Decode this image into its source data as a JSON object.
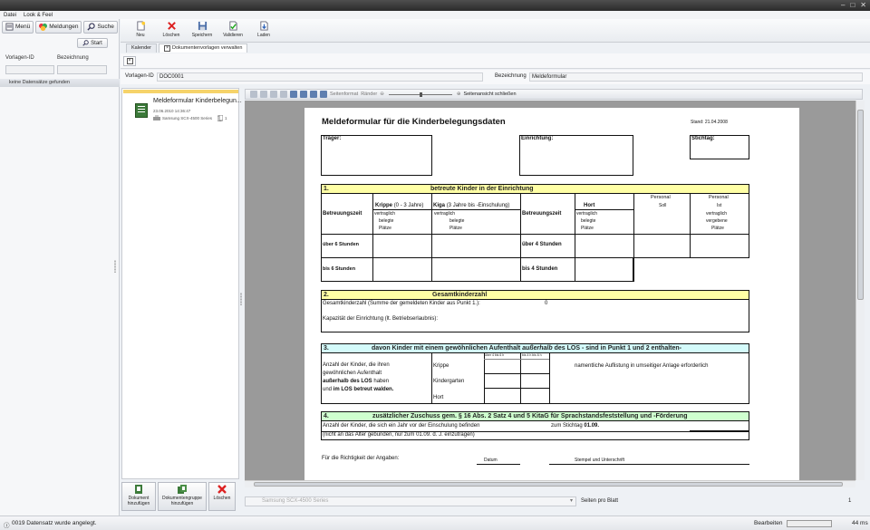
{
  "menu": [
    "Datei",
    "Look & Feel"
  ],
  "left_toolbar": {
    "menu_label": "Menü",
    "messages_label": "Meldungen",
    "search_label": "Suche",
    "start_label": "Start"
  },
  "search_form": {
    "template_id_label": "Vorlagen-ID",
    "name_label": "Bezeichnung",
    "no_records": "keine Datensätze gefunden"
  },
  "ribbon": [
    {
      "label": "Neu",
      "icon": "new-document-icon"
    },
    {
      "label": "Löschen",
      "icon": "delete-icon"
    },
    {
      "label": "Speichern",
      "icon": "save-icon"
    },
    {
      "label": "Validieren",
      "icon": "validate-icon"
    },
    {
      "label": "Laden",
      "icon": "load-icon"
    }
  ],
  "tabs": [
    {
      "label": "Kalender"
    },
    {
      "label": "Dokumentenvorlagen verwalten"
    }
  ],
  "record": {
    "template_id_label": "Vorlagen-ID",
    "template_id_value": "DOC0001",
    "name_label": "Bezeichnung",
    "name_value": "Meldeformular"
  },
  "document": {
    "title": "Meldeformular Kinderbelegun...",
    "date": "23.06.2010 14:36:47",
    "printer": "Samsung SCX-4500 Series",
    "copies": "1"
  },
  "doc_buttons": [
    {
      "line1": "Dokument",
      "line2": "hinzufügen",
      "icon": "add-document-icon"
    },
    {
      "line1": "Dokumentengruppe",
      "line2": "hinzufügen",
      "icon": "add-document-group-icon"
    },
    {
      "line1": "Löschen",
      "line2": "",
      "icon": "delete-icon"
    }
  ],
  "preview_toolbar": {
    "page_format": "Seitenformat",
    "margins": "Ränder",
    "close_view": "Seitenansicht schließen"
  },
  "form": {
    "title": "Meldeformular für die Kinderbelegungsdaten",
    "stand": "Stand: 21.04.2008",
    "traeger": "Träger:",
    "einrichtung": "Einrichtung:",
    "stichtag": "Stichtag:",
    "s1_num": "1.",
    "s1_title": "betreute Kinder in der Einrichtung",
    "betreuungszeit": "Betreuungszeit",
    "krippe": "Krippe",
    "krippe_age": "(0 - 3 Jahre)",
    "kiga": "Kiga",
    "kiga_age": "(3 Jahre bis -Einschulung)",
    "hort": "Hort",
    "personal": "Personal",
    "soll": "Soll",
    "ist": "Ist",
    "vertraglich": "vertraglich",
    "belegte": "belegte",
    "plaetze": "Plätze",
    "vergebene": "vergebene",
    "ueber6": "über 6 Stunden",
    "bis6": "bis 6 Stunden",
    "ueber4": "über 4 Stunden",
    "bis4": "bis 4 Stunden",
    "s2_num": "2.",
    "s2_title": "Gesamtkinderzahl",
    "s2_line1": "Gesamtkinderzahl (Summe der gemeldeten Kinder aus Punkt 1.):",
    "s2_value": "0",
    "s2_line2": "Kapazität der Einrichtung (lt. Betriebserlaubnis):",
    "s3_num": "3.",
    "s3_title_a": "davon Kinder mit einem gewöhnlichen Aufenthalt ",
    "s3_title_b": "außerhalb",
    "s3_title_c": " des LOS - sind in Punkt 1 und 2 enthalten-",
    "s3_text1": "Anzahl der Kinder, die ihren",
    "s3_text2": "gewöhnlichen Aufenthalt",
    "s3_text3a": "außerhalb des LOS",
    "s3_text3b": " haben",
    "s3_text4a": "und ",
    "s3_text4b": "im LOS betreut walden.",
    "s3_krippe": "Krippe",
    "s3_kiga": "Kindergarten",
    "s3_hort": "Hort",
    "s3_col1": "über 4 bis 6 h",
    "s3_col2": "bis 4 h bis 6 h",
    "s3_note": "namentliche Auflistung in umseitiger Anlage erforderlich",
    "s4_num": "4.",
    "s4_title": "zusätzlicher Zuschuss gem. § 16 Abs. 2 Satz 4 und 5 KitaG für Sprachstandsfeststellung und -Förderung",
    "s4_line1": "Anzahl der Kinder, die sich ein Jahr vor der Einschulung befinden",
    "s4_stichtag": "zum Stichtag",
    "s4_date": "01.09.",
    "s4_line2": "(nicht an das Alter gebunden, nur zum 01.09. d. J. einzutragen)",
    "sign_text": "Für die Richtigkeit der Angaben:",
    "sign_date": "Datum",
    "sign_stamp": "Stempel und Unterschrift"
  },
  "preview_bottom": {
    "printer": "Samsung SCX-4500 Series",
    "pages_label": "Seiten pro Blatt",
    "pages_value": "1"
  },
  "status": {
    "message": "0019 Datensatz wurde angelegt.",
    "mode": "Bearbeiten",
    "time": "44 ms"
  }
}
